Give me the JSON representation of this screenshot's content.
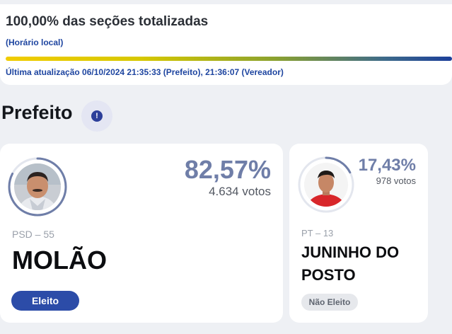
{
  "status": {
    "title": "100,00% das seções totalizadas",
    "local_time_label": "(Horário local)",
    "progress_percent": 100,
    "last_update": "Última atualização 06/10/2024 21:35:33 (Prefeito), 21:36:07 (Vereador)"
  },
  "section": {
    "title": "Prefeito",
    "info_icon": "info-icon",
    "info_glyph": "!"
  },
  "candidates": [
    {
      "percent": "82,57%",
      "percent_value": 82.57,
      "votes": "4.634 votos",
      "party": "PSD – 55",
      "name": "MOLÃO",
      "status": "Eleito",
      "status_color": "#2c4ca8"
    },
    {
      "percent": "17,43%",
      "percent_value": 17.43,
      "votes": "978 votos",
      "party": "PT – 13",
      "name": "JUNINHO DO POSTO",
      "status": "Não Eleito",
      "status_color": "#e6e8ec"
    }
  ],
  "colors": {
    "accent": "#2c4ca8",
    "percent_text": "#6f7ea8",
    "ring_track": "#e3e6ee",
    "ring_fill": "#6f7ea8"
  }
}
